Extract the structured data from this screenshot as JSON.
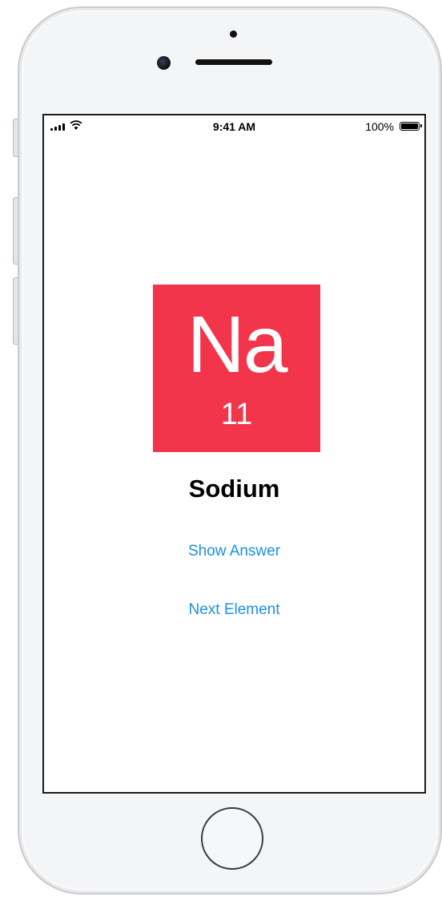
{
  "status_bar": {
    "time": "9:41 AM",
    "battery_percent": "100%",
    "battery_level": 1.0,
    "signal_icon": "cellular-signal-icon",
    "wifi_icon": "wifi-icon",
    "battery_icon": "battery-icon"
  },
  "element": {
    "symbol": "Na",
    "atomic_number": "11",
    "name": "Sodium",
    "tile_color": "#f3354c"
  },
  "actions": {
    "show_answer_label": "Show Answer",
    "next_element_label": "Next Element",
    "link_color": "#1b8fe6"
  }
}
